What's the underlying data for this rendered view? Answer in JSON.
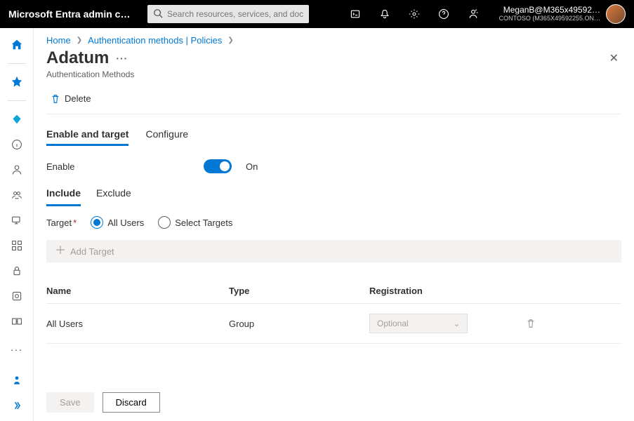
{
  "topbar": {
    "brand": "Microsoft Entra admin cent…",
    "search_placeholder": "Search resources, services, and docs (G+/)",
    "user_primary": "MeganB@M365x49592…",
    "user_secondary": "CONTOSO (M365X49592255.ON…"
  },
  "breadcrumb": {
    "home": "Home",
    "section": "Authentication methods | Policies"
  },
  "page": {
    "title": "Adatum",
    "subtitle": "Authentication Methods"
  },
  "commands": {
    "delete": "Delete"
  },
  "tabs": {
    "enable_target": "Enable and target",
    "configure": "Configure"
  },
  "enable": {
    "label": "Enable",
    "state": "On"
  },
  "subtabs": {
    "include": "Include",
    "exclude": "Exclude"
  },
  "target": {
    "label": "Target",
    "all_users": "All Users",
    "select_targets": "Select Targets",
    "add_target": "Add Target"
  },
  "table": {
    "col_name": "Name",
    "col_type": "Type",
    "col_reg": "Registration",
    "rows": [
      {
        "name": "All Users",
        "type": "Group",
        "registration": "Optional"
      }
    ]
  },
  "footer": {
    "save": "Save",
    "discard": "Discard"
  }
}
